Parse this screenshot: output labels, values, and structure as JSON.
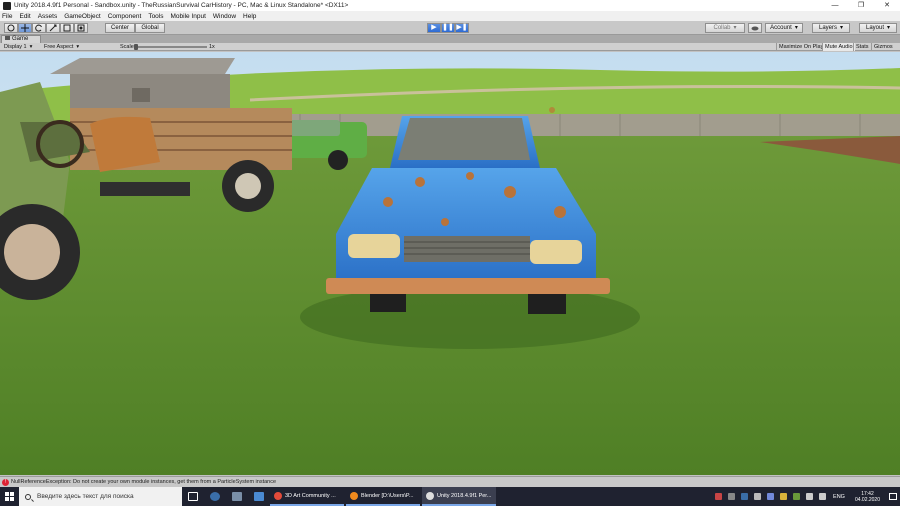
{
  "window": {
    "title": "Unity 2018.4.9f1 Personal - Sandbox.unity - TheRussianSurvival CarHistory - PC, Mac & Linux Standalone* <DX11>",
    "controls": [
      "—",
      "❐",
      "✕"
    ]
  },
  "menu": [
    "File",
    "Edit",
    "Assets",
    "GameObject",
    "Component",
    "Tools",
    "Mobile Input",
    "Window",
    "Help"
  ],
  "toolbar": {
    "pivot": "Center",
    "space": "Global",
    "play": "▶",
    "pause": "❚❚",
    "step": "▶❚",
    "collab": "Collab",
    "cloud_icon": "cloud-icon",
    "account": "Account",
    "layers": "Layers",
    "layout": "Layout"
  },
  "game_tab": {
    "label": "Game",
    "display": "Display 1",
    "aspect": "Free Aspect",
    "scale_label": "Scale",
    "scale_value": "1x",
    "scale_fraction": 0.0,
    "maximize_on_play": "Maximize On Play",
    "mute_audio": "Mute Audio",
    "stats": "Stats",
    "gizmos": "Gizmos"
  },
  "console": {
    "message": "NullReferenceException: Do not create your own module instances, get them from a ParticleSystem instance"
  },
  "taskbar": {
    "search_placeholder": "Введите здесь текст для поиска",
    "tasks": [
      {
        "label": "3D Art Community ...",
        "color": "#e34b3a"
      },
      {
        "label": "Blender [D:\\Users\\P...",
        "color": "#f08a1d"
      },
      {
        "label": "Unity 2018.4.9f1 Per...",
        "color": "#dddddd"
      }
    ],
    "lang": "ENG",
    "time": "17:42",
    "date": "04.02.2020"
  },
  "colors": {
    "sky": "#cfe3f2",
    "grass": "#5f8f2e",
    "car_blue": "#3f86d6",
    "rust": "#c2773a",
    "taskbar": "#1f2230"
  }
}
